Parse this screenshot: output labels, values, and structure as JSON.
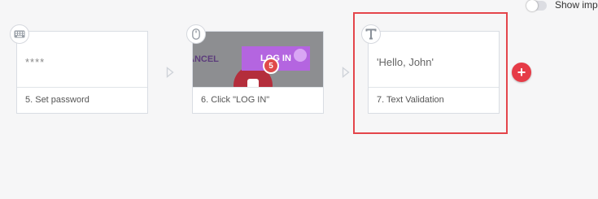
{
  "toggle": {
    "label": "Show imp",
    "on": false
  },
  "steps": [
    {
      "caption": "5. Set password",
      "preview_text": "****",
      "icon": "keyboard-icon"
    },
    {
      "caption": "6. Click \"LOG IN\"",
      "icon": "mouse-icon",
      "screenshot": {
        "cancel_label": "ANCEL",
        "button_label": "LOG IN",
        "badge": "5"
      }
    },
    {
      "caption": "7. Text Validation",
      "preview_text": "'Hello, John'",
      "icon": "text-t-icon"
    }
  ],
  "add_button": {
    "label": "+"
  },
  "colors": {
    "accent": "#e63b47",
    "highlight": "#e4454b",
    "login_button": "#b465e0"
  }
}
